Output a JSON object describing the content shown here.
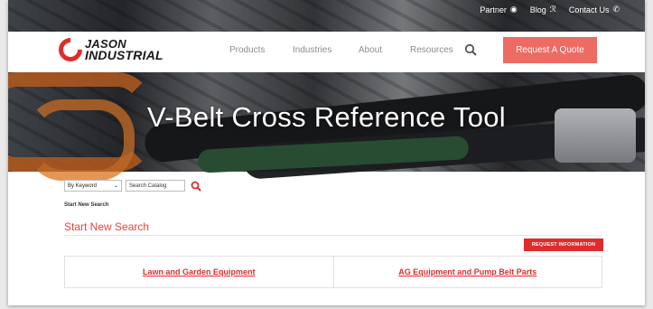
{
  "colors": {
    "brand_red": "#e02b2b",
    "quote_button": "#ee6b63",
    "nav_text": "#8c8c8c"
  },
  "utility_bar": {
    "items": [
      {
        "label": "Partner",
        "icon": "partner-icon"
      },
      {
        "label": "Blog",
        "icon": "rss-icon"
      },
      {
        "label": "Contact Us",
        "icon": "phone-icon"
      }
    ]
  },
  "header": {
    "logo": {
      "line1": "JASON",
      "line2": "INDUSTRIAL"
    },
    "nav": [
      "Products",
      "Industries",
      "About",
      "Resources"
    ],
    "search_icon": "search-icon",
    "quote_button": "Request A Quote"
  },
  "hero": {
    "title": "V-Belt Cross Reference Tool"
  },
  "search": {
    "mode_selected": "By Keyword",
    "input_placeholder": "Search Catalog",
    "submit_icon": "search-icon"
  },
  "breadcrumb": "Start New Search",
  "section_title": "Start New Search",
  "request_button": "REQUEST INFORMATION",
  "categories": [
    "Lawn and Garden Equipment",
    "AG Equipment and Pump Belt Parts"
  ]
}
